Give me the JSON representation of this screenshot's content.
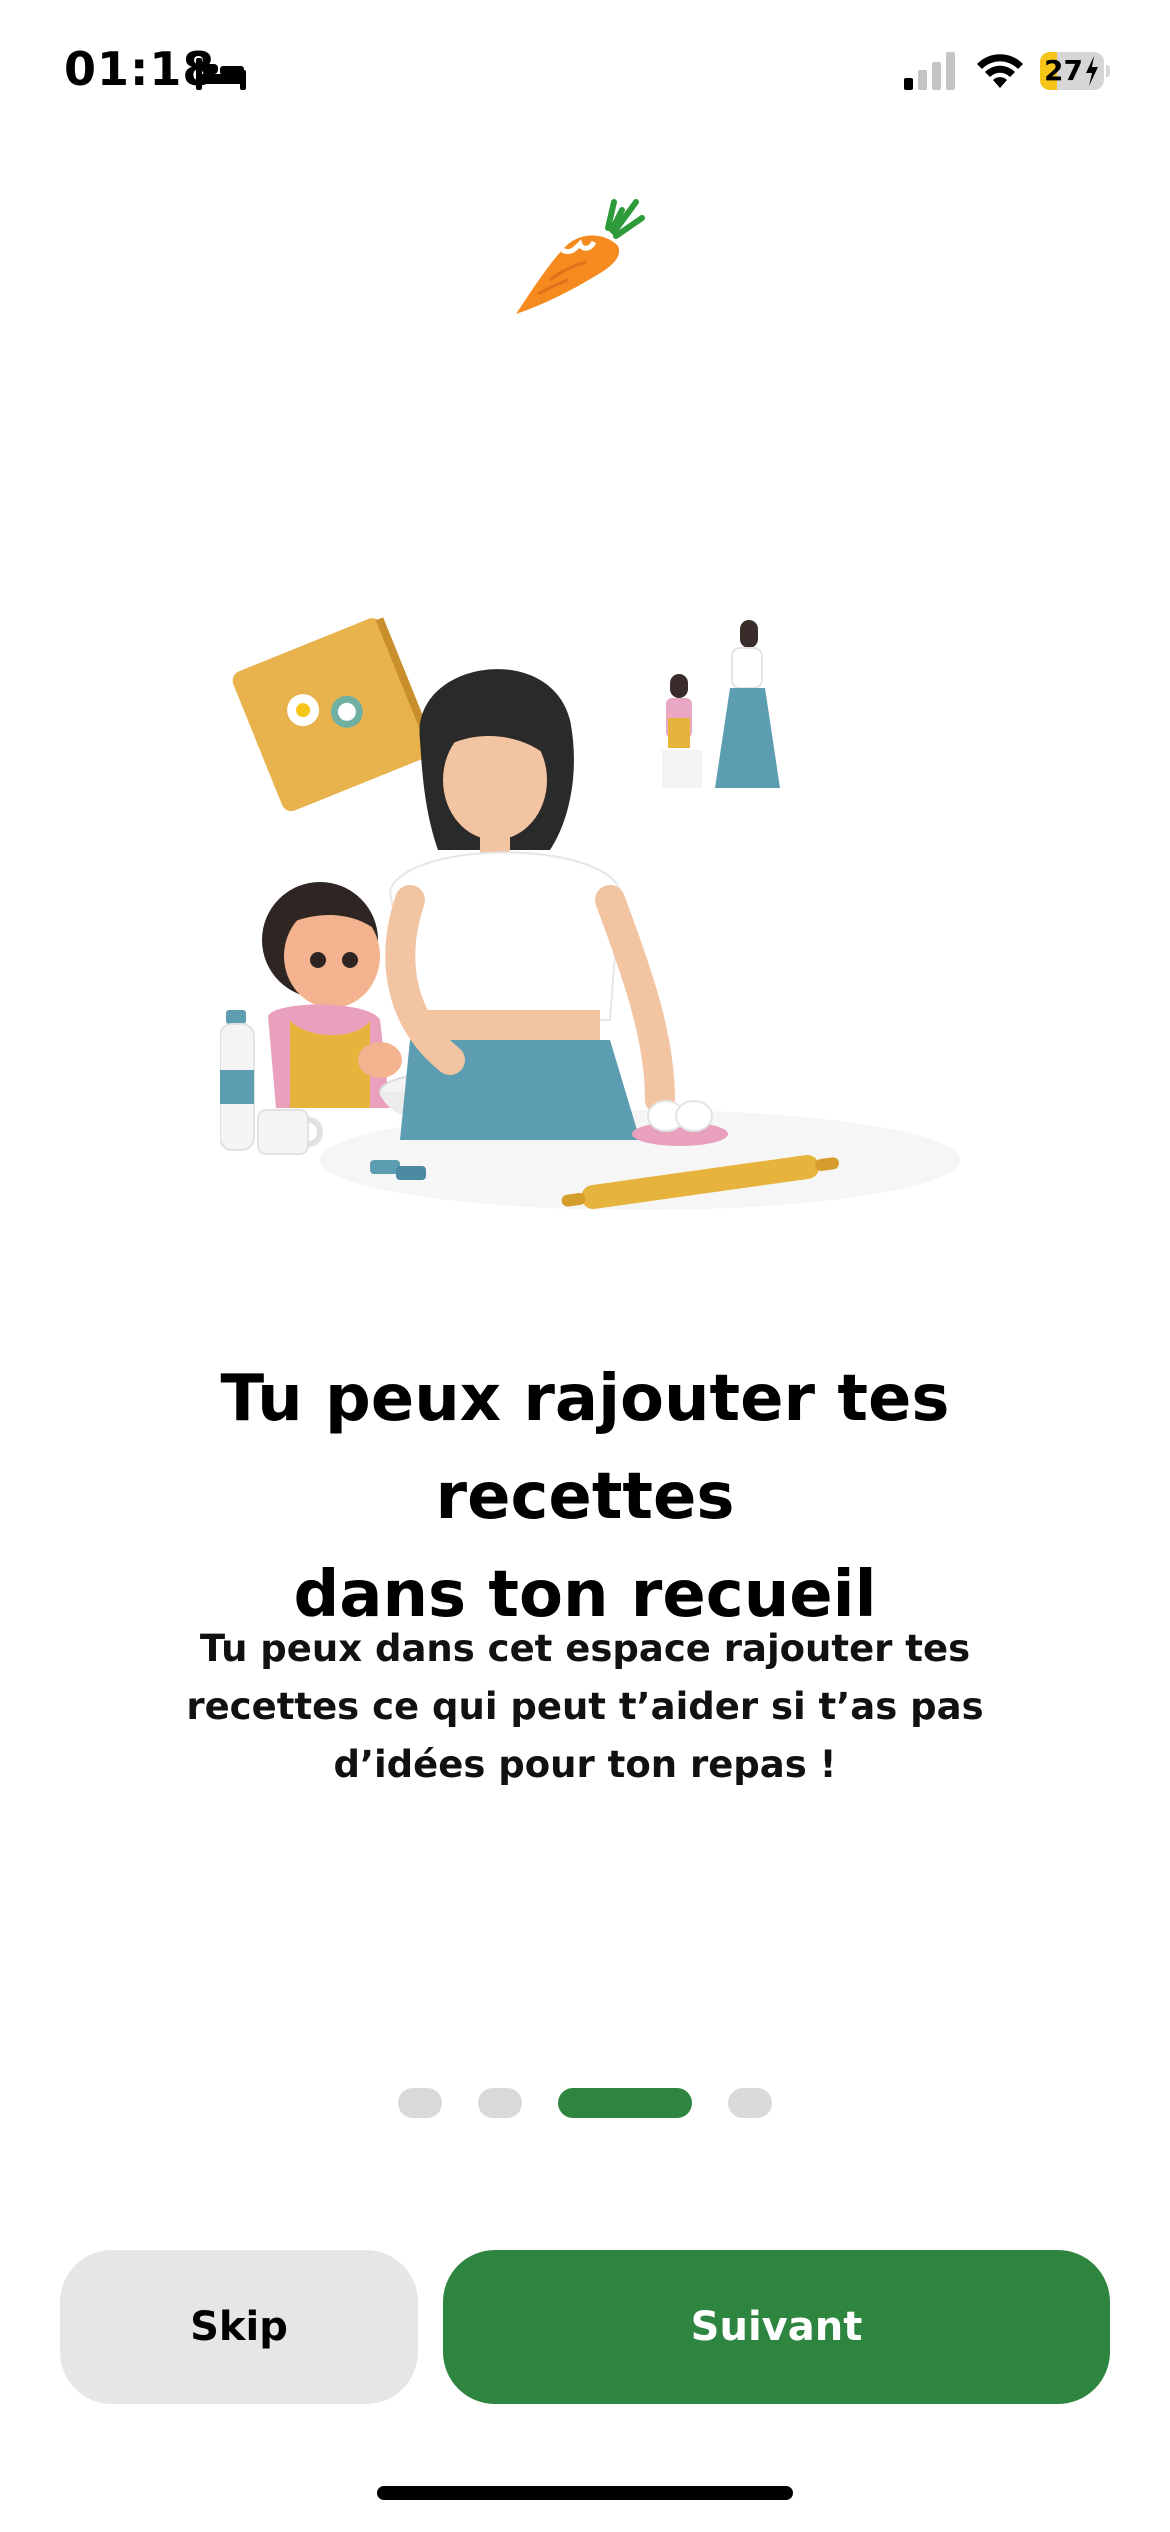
{
  "status_bar": {
    "time": "01:18",
    "battery_level": "27",
    "battery_percent": 27,
    "charging": true,
    "icons": [
      "bed-icon",
      "signal-icon",
      "wifi-icon",
      "battery-icon"
    ]
  },
  "logo": {
    "icon": "carrot-icon"
  },
  "illustration": {
    "icon": "mother-daughter-cooking-illustration"
  },
  "onboarding": {
    "title_line1": "Tu peux rajouter tes recettes",
    "title_line2": "dans ton recueil",
    "description_line1": "Tu peux dans cet espace rajouter tes",
    "description_line2": "recettes ce qui peut t’aider si t’as pas",
    "description_line3": "d’idées pour ton repas !"
  },
  "pager": {
    "total": 4,
    "current": 3
  },
  "buttons": {
    "skip_label": "Skip",
    "next_label": "Suivant"
  },
  "colors": {
    "accent": "#2e8540",
    "inactive_dot": "#d9d9d9",
    "skip_bg": "#e6e6e6",
    "battery_charging": "#f5c518"
  }
}
